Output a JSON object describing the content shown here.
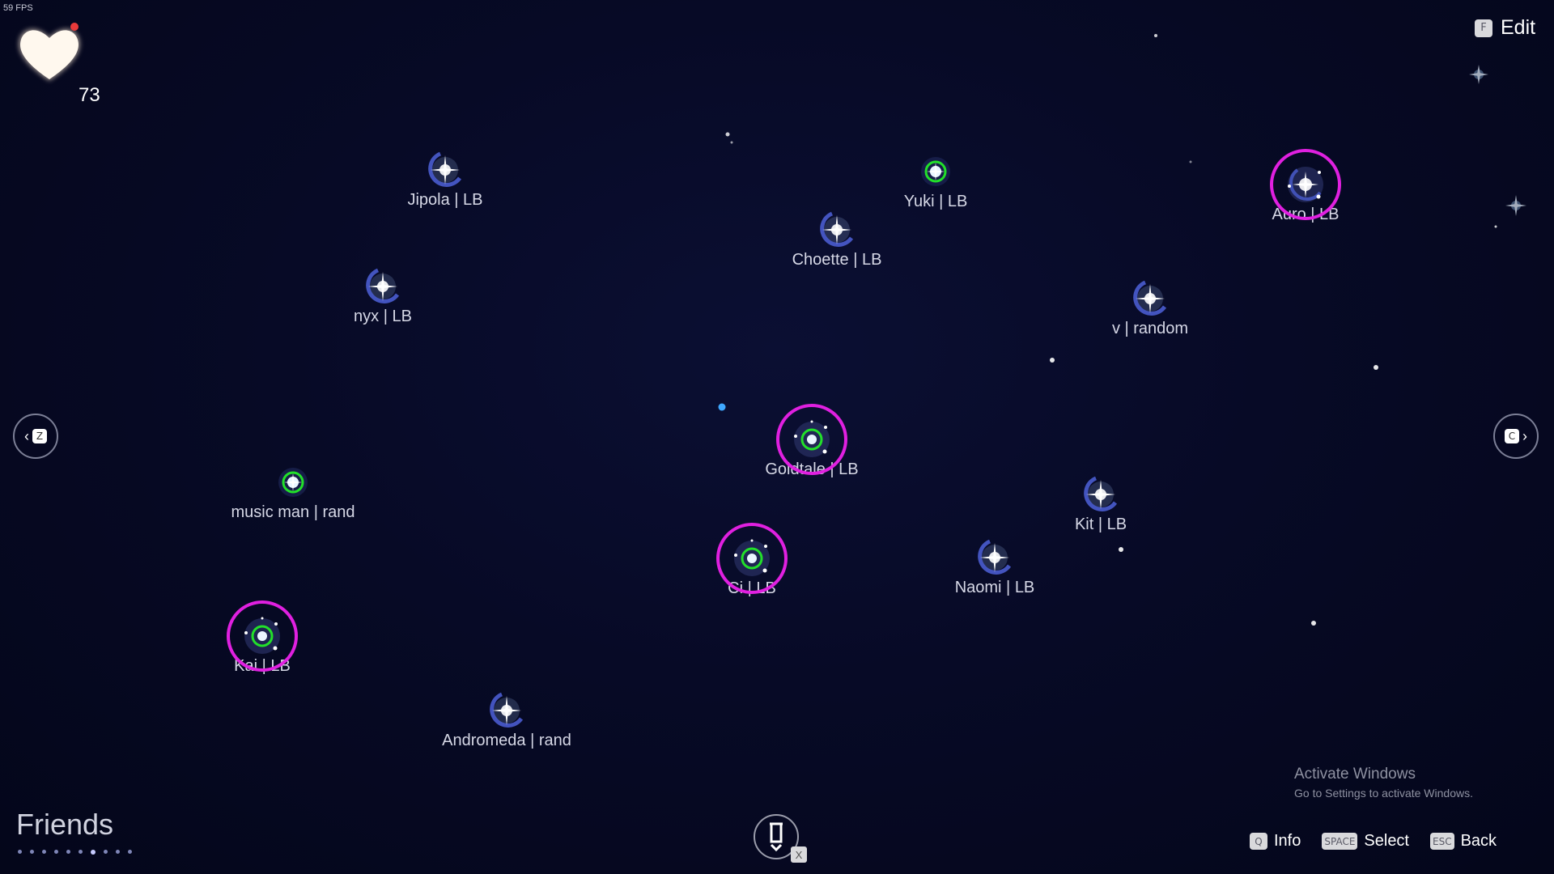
{
  "hud": {
    "fps": "59 FPS",
    "heart_count": "73",
    "edit": {
      "key": "F",
      "label": "Edit"
    }
  },
  "friends": [
    {
      "label": "Jipola | LB",
      "style": "blue",
      "highlighted": false
    },
    {
      "label": "Yuki | LB",
      "style": "green",
      "highlighted": false
    },
    {
      "label": "Choette | LB",
      "style": "blue",
      "highlighted": false
    },
    {
      "label": "Auro | LB",
      "style": "orbit",
      "highlighted": true
    },
    {
      "label": "nyx | LB",
      "style": "blue",
      "highlighted": false
    },
    {
      "label": "v | random",
      "style": "blue",
      "highlighted": false
    },
    {
      "label": "Goldtale | LB",
      "style": "green-orbit",
      "highlighted": true
    },
    {
      "label": "music man | rand",
      "style": "green",
      "highlighted": false
    },
    {
      "label": "Kit | LB",
      "style": "blue",
      "highlighted": false
    },
    {
      "label": "Ci | LB",
      "style": "green-orbit",
      "highlighted": true
    },
    {
      "label": "Naomi | LB",
      "style": "blue",
      "highlighted": false
    },
    {
      "label": "Kai | LB",
      "style": "green-orbit",
      "highlighted": true
    },
    {
      "label": "Andromeda | rand",
      "style": "blue",
      "highlighted": false
    }
  ],
  "nav": {
    "prev_key": "Z",
    "next_key": "C",
    "tool_key": "X"
  },
  "footer": {
    "title": "Friends",
    "page_count": 10,
    "active_page": 7,
    "hints": [
      {
        "key": "Q",
        "label": "Info"
      },
      {
        "key": "SPACE",
        "label": "Select"
      },
      {
        "key": "ESC",
        "label": "Back"
      }
    ]
  },
  "watermark": {
    "line1": "Activate Windows",
    "line2": "Go to Settings to activate Windows."
  },
  "colors": {
    "background": "#06081f",
    "highlight_ring": "#e020e0",
    "green_ring": "#22e02a",
    "star_glow": "#a9c8ff",
    "moon_arc": "#4a5ccf"
  }
}
